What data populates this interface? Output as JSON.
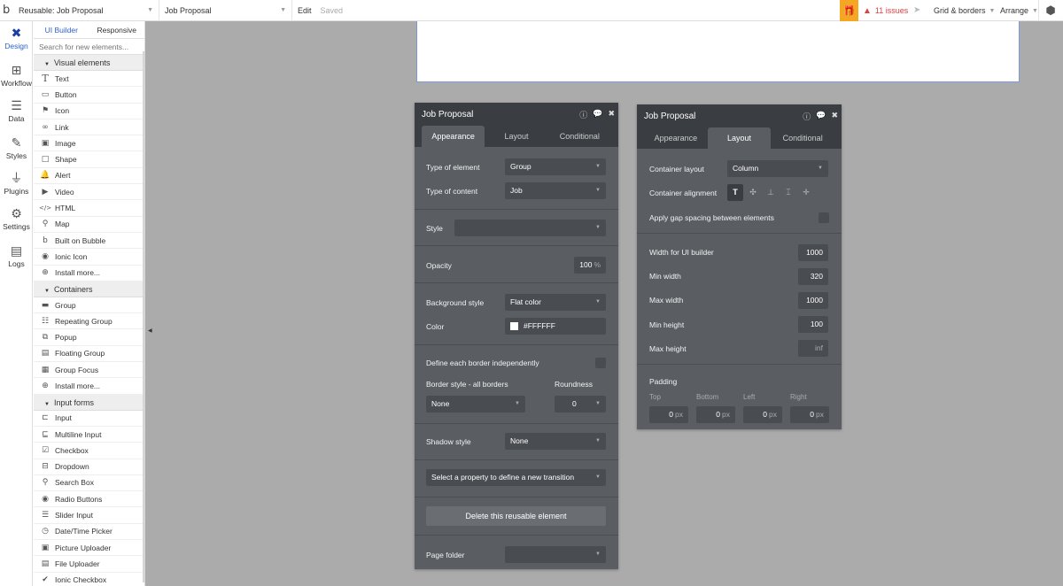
{
  "topbar": {
    "logo": "b",
    "page_select": "Reusable: Job Proposal",
    "type_select": "Job Proposal",
    "edit_label": "Edit",
    "saved_label": "Saved",
    "issues_label": "11 issues",
    "grid_label": "Grid & borders",
    "arrange_label": "Arrange"
  },
  "nav": [
    {
      "label": "Design",
      "icon": "design-icon"
    },
    {
      "label": "Workflow",
      "icon": "workflow-icon"
    },
    {
      "label": "Data",
      "icon": "data-icon"
    },
    {
      "label": "Styles",
      "icon": "styles-icon"
    },
    {
      "label": "Plugins",
      "icon": "plugins-icon"
    },
    {
      "label": "Settings",
      "icon": "settings-icon"
    },
    {
      "label": "Logs",
      "icon": "logs-icon"
    }
  ],
  "palette": {
    "tabs": [
      "UI Builder",
      "Responsive"
    ],
    "search_placeholder": "Search for new elements...",
    "sections": [
      {
        "title": "Visual elements",
        "items": [
          {
            "label": "Text",
            "icon": "text-icon"
          },
          {
            "label": "Button",
            "icon": "button-icon"
          },
          {
            "label": "Icon",
            "icon": "flag-icon"
          },
          {
            "label": "Link",
            "icon": "link-icon"
          },
          {
            "label": "Image",
            "icon": "image-icon"
          },
          {
            "label": "Shape",
            "icon": "shape-icon"
          },
          {
            "label": "Alert",
            "icon": "bell-icon"
          },
          {
            "label": "Video",
            "icon": "video-icon"
          },
          {
            "label": "HTML",
            "icon": "code-icon"
          },
          {
            "label": "Map",
            "icon": "map-pin-icon"
          },
          {
            "label": "Built on Bubble",
            "icon": "bubble-logo-icon"
          },
          {
            "label": "Ionic Icon",
            "icon": "ionic-icon"
          },
          {
            "label": "Install more...",
            "icon": "plus-circle-icon"
          }
        ]
      },
      {
        "title": "Containers",
        "items": [
          {
            "label": "Group",
            "icon": "folder-icon"
          },
          {
            "label": "Repeating Group",
            "icon": "repeating-group-icon"
          },
          {
            "label": "Popup",
            "icon": "popup-icon"
          },
          {
            "label": "Floating Group",
            "icon": "floating-group-icon"
          },
          {
            "label": "Group Focus",
            "icon": "group-focus-icon"
          },
          {
            "label": "Install more...",
            "icon": "plus-circle-icon"
          }
        ]
      },
      {
        "title": "Input forms",
        "items": [
          {
            "label": "Input",
            "icon": "input-icon"
          },
          {
            "label": "Multiline Input",
            "icon": "multiline-input-icon"
          },
          {
            "label": "Checkbox",
            "icon": "checkbox-icon"
          },
          {
            "label": "Dropdown",
            "icon": "dropdown-icon"
          },
          {
            "label": "Search Box",
            "icon": "search-icon"
          },
          {
            "label": "Radio Buttons",
            "icon": "radio-icon"
          },
          {
            "label": "Slider Input",
            "icon": "slider-icon"
          },
          {
            "label": "Date/Time Picker",
            "icon": "clock-icon"
          },
          {
            "label": "Picture Uploader",
            "icon": "picture-uploader-icon"
          },
          {
            "label": "File Uploader",
            "icon": "file-uploader-icon"
          },
          {
            "label": "Ionic Checkbox",
            "icon": "ionic-checkbox-icon"
          }
        ]
      }
    ]
  },
  "appearance_panel": {
    "title": "Job Proposal",
    "tabs": [
      "Appearance",
      "Layout",
      "Conditional"
    ],
    "type_of_element_label": "Type of element",
    "type_of_element_value": "Group",
    "type_of_content_label": "Type of content",
    "type_of_content_value": "Job",
    "style_label": "Style",
    "style_value": "",
    "opacity_label": "Opacity",
    "opacity_value": "100",
    "opacity_unit": "%",
    "background_style_label": "Background style",
    "background_style_value": "Flat color",
    "color_label": "Color",
    "color_value": "#FFFFFF",
    "define_border_label": "Define each border independently",
    "border_style_label": "Border style - all borders",
    "roundness_label": "Roundness",
    "border_style_value": "None",
    "roundness_value": "0",
    "shadow_style_label": "Shadow style",
    "shadow_style_value": "None",
    "transition_placeholder": "Select a property to define a new transition",
    "delete_button": "Delete this reusable element",
    "page_folder_label": "Page folder",
    "page_folder_value": ""
  },
  "layout_panel": {
    "title": "Job Proposal",
    "tabs": [
      "Appearance",
      "Layout",
      "Conditional"
    ],
    "container_layout_label": "Container layout",
    "container_layout_value": "Column",
    "container_alignment_label": "Container alignment",
    "apply_gap_label": "Apply gap spacing between elements",
    "width_label": "Width for UI builder",
    "width_value": "1000",
    "min_width_label": "Min width",
    "min_width_value": "320",
    "max_width_label": "Max width",
    "max_width_value": "1000",
    "min_height_label": "Min height",
    "min_height_value": "100",
    "max_height_label": "Max height",
    "max_height_value": "inf",
    "padding_label": "Padding",
    "padding_sides": [
      "Top",
      "Bottom",
      "Left",
      "Right"
    ],
    "padding_values": [
      "0",
      "0",
      "0",
      "0"
    ],
    "padding_unit": "px"
  }
}
